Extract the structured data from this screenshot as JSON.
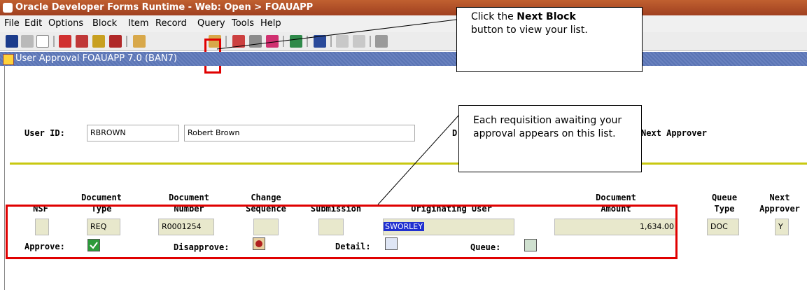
{
  "window": {
    "title": "Oracle Developer Forms Runtime - Web:  Open > FOAUAPP"
  },
  "menu": [
    {
      "label": "File"
    },
    {
      "label": "Edit"
    },
    {
      "label": "Options"
    },
    {
      "label": "Block"
    },
    {
      "label": "Item"
    },
    {
      "label": "Record"
    },
    {
      "label": "Query"
    },
    {
      "label": "Tools"
    },
    {
      "label": "Help"
    }
  ],
  "toolbar": {
    "icons": [
      "save-icon",
      "rollback-icon",
      "print-icon",
      "previous-block-icon",
      "next-block-icon",
      "previous-record-icon",
      "next-record-icon",
      "enter-query-icon",
      "next-block-highlight-icon",
      "search-icon",
      "remove-record-icon",
      "insert-record-icon",
      "help-icon",
      "print-preview-icon",
      "clear-field-icon",
      "clear-record-icon",
      "speaker-icon"
    ]
  },
  "form": {
    "title": "User Approval  FOAUAPP  7.0  (BAN7)"
  },
  "user": {
    "id_label": "User ID:",
    "id_value": "RBROWN",
    "name_value": "Robert Brown",
    "partial_label": "D",
    "next_approver_label": "Next Approver"
  },
  "columns": {
    "nsf": "NSF",
    "doc_type": [
      "Document",
      "Type"
    ],
    "doc_number": [
      "Document",
      "Number"
    ],
    "change_seq": [
      "Change",
      "Sequence"
    ],
    "submission": "Submission",
    "orig_user": "Originating User",
    "doc_amount": [
      "Document",
      "Amount"
    ],
    "queue_type": [
      "Queue",
      "Type"
    ],
    "next_approver": [
      "Next",
      "Approver"
    ]
  },
  "record": {
    "nsf": "",
    "doc_type": "REQ",
    "doc_number": "R0001254",
    "change_seq": "",
    "submission": "",
    "orig_user": "SWORLEY",
    "doc_amount": "1,634.00",
    "queue_type": "DOC",
    "next_approver": "Y"
  },
  "actions": {
    "approve": "Approve:",
    "disapprove": "Disapprove:",
    "detail": "Detail:",
    "queue": "Queue:"
  },
  "callouts": {
    "next_block": {
      "line1": "Click the ",
      "bold": "Next Block",
      "line2": "button to view your list."
    },
    "list": {
      "text": "Each requisition awaiting your approval appears on this list."
    }
  },
  "colors": {
    "highlight_red": "#e00000",
    "field_bg": "#e8e8cc",
    "title_bar": "#b04c26",
    "form_title_bar": "#5a74b4",
    "divider": "#c8c810"
  }
}
